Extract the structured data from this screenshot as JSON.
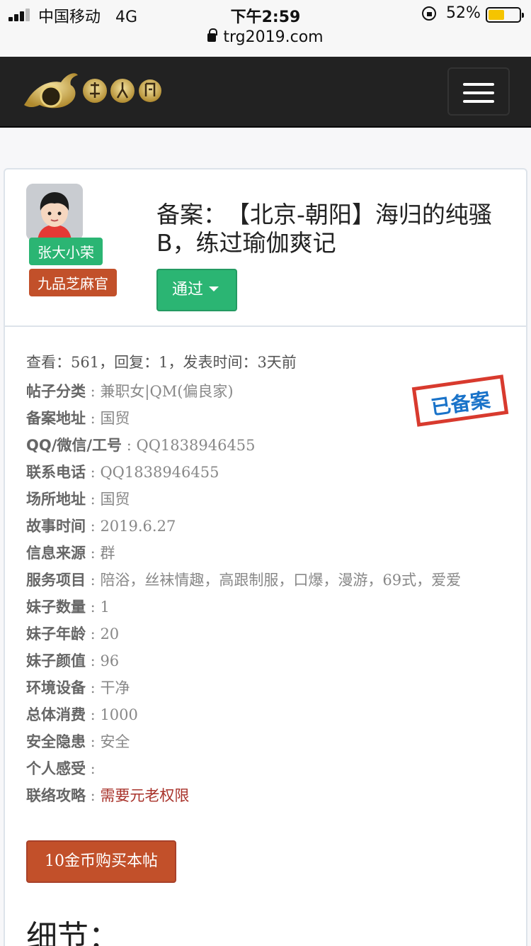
{
  "status_bar": {
    "carrier": "中国移动",
    "network": "4G",
    "time": "下午2:59",
    "battery_text": "52%",
    "battery_level": 0.52,
    "url": "trg2019.com"
  },
  "navbar": {
    "logo_icon": "dragon-logo-icon",
    "menu_icon": "hamburger-icon"
  },
  "post": {
    "username": "张大小荣",
    "rank": "九品芝麻官",
    "title": "备案：　【北京-朝阳】海归的纯骚B，练过瑜伽爽记",
    "status_button": "通过",
    "stats": "查看：561，回复：1，发表时间：3天前",
    "stamp": "已备案",
    "fields": [
      {
        "label": "帖子分类",
        "value": "兼职女|QM(偏良家)"
      },
      {
        "label": "备案地址",
        "value": "国贸"
      },
      {
        "label": "QQ/微信/工号",
        "value": "QQ1838946455"
      },
      {
        "label": "联系电话",
        "value": "QQ1838946455"
      },
      {
        "label": "场所地址",
        "value": "国贸"
      },
      {
        "label": "故事时间",
        "value": "2019.6.27"
      },
      {
        "label": "信息来源",
        "value": "群"
      },
      {
        "label": "服务项目",
        "value": "陪浴，丝袜情趣，高跟制服，口爆，漫游，69式，爱爱"
      },
      {
        "label": "妹子数量",
        "value": "1"
      },
      {
        "label": "妹子年龄",
        "value": "20"
      },
      {
        "label": "妹子颜值",
        "value": "96"
      },
      {
        "label": "环境设备",
        "value": "干净"
      },
      {
        "label": "总体消费",
        "value": "1000"
      },
      {
        "label": "安全隐患",
        "value": "安全"
      },
      {
        "label": "个人感受",
        "value": ""
      },
      {
        "label": "联络攻略",
        "value": "需要元老权限"
      }
    ],
    "buy_button": "10金币购买本帖",
    "detail_heading": "细节："
  },
  "colors": {
    "green": "#2bb573",
    "rust": "#c2502a",
    "navbar_bg": "#222222",
    "stamp_red": "#d83a2e",
    "stamp_blue": "#1a73c9"
  }
}
